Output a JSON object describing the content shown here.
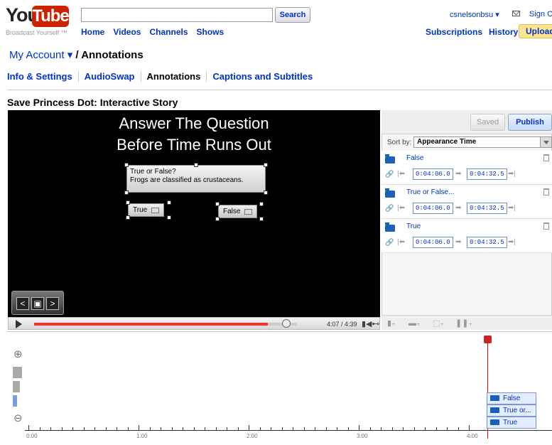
{
  "masthead": {
    "logo_you": "You",
    "logo_tube": "Tube",
    "tagline": "Broadcast Yourself ™",
    "search_value": "",
    "search_button": "Search",
    "nav": [
      "Home",
      "Videos",
      "Channels",
      "Shows"
    ],
    "username": "csnelsonbsu ▾",
    "sign_out": "Sign O",
    "subscriptions": "Subscriptions",
    "history": "History",
    "upload": "Upload"
  },
  "breadcrumb": {
    "account": "My Account ▾",
    "separator": " / ",
    "current": "Annotations"
  },
  "subnav": {
    "items": [
      "Info & Settings",
      "AudioSwap",
      "Annotations",
      "Captions and Subtitles"
    ],
    "active_index": 2
  },
  "video": {
    "title": "Save Princess Dot: Interactive Story",
    "heading_line1": "Answer The Question",
    "heading_line2": "Before Time Runs Out",
    "question_line1": "True or False?",
    "question_line2": "Frogs are classified as crustaceans.",
    "btn_true": "True",
    "btn_false": "False",
    "time": "4:07 / 4:39",
    "progress": 0.888
  },
  "panel": {
    "saved": "Saved",
    "publish": "Publish",
    "sort_label": "Sort by:",
    "sort_value": "Appearance Time",
    "annotations": [
      {
        "title": "False",
        "start": "0:04:06.0",
        "end": "0:04:32.5"
      },
      {
        "title": "True or False...",
        "start": "0:04:06.0",
        "end": "0:04:32.5"
      },
      {
        "title": "True",
        "start": "0:04:06.0",
        "end": "0:04:32.5"
      }
    ]
  },
  "timeline": {
    "labels": [
      "0:00",
      "1:00",
      "2:00",
      "3:00",
      "4:00"
    ],
    "items": [
      "False",
      "True or...",
      "True"
    ]
  }
}
